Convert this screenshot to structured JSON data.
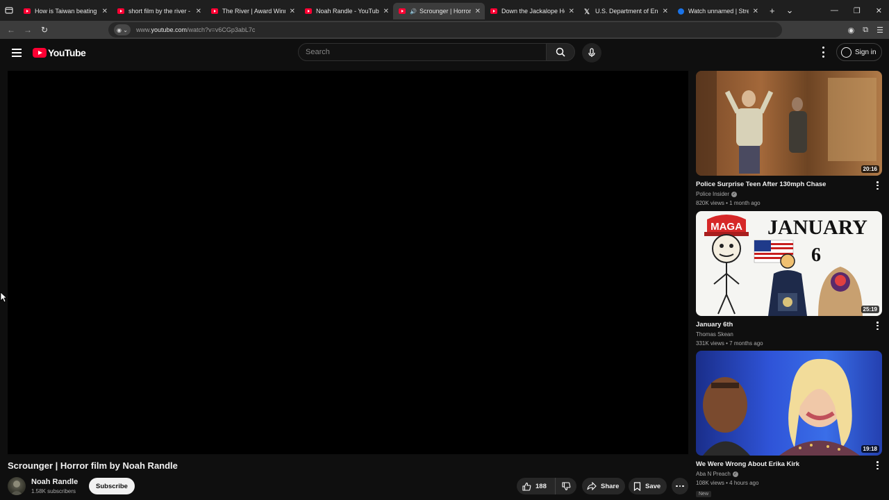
{
  "browser": {
    "tabs": [
      {
        "title": "How is Taiwan beating eve",
        "favicon": "youtube-icon",
        "active": false
      },
      {
        "title": "short film by the river - You",
        "favicon": "youtube-icon",
        "active": false
      },
      {
        "title": "The River | Award Winning",
        "favicon": "youtube-icon",
        "active": false
      },
      {
        "title": "Noah Randle - YouTube",
        "favicon": "youtube-icon",
        "active": false
      },
      {
        "title": "Scrounger | Horror film",
        "favicon": "youtube-icon",
        "active": true,
        "audio": true
      },
      {
        "title": "Down the Jackalope Hole |",
        "favicon": "youtube-icon",
        "active": false
      },
      {
        "title": "U.S. Department of Energy",
        "favicon": "x-icon",
        "active": false
      },
      {
        "title": "Watch unnamed | Strea",
        "favicon": "globe-icon",
        "active": false
      }
    ],
    "url_prefix": "www.",
    "url_host": "youtube.com",
    "url_path": "/watch?v=v6CGp3abL7c"
  },
  "header": {
    "logo_text": "YouTube",
    "search_placeholder": "Search",
    "signin_label": "Sign in"
  },
  "video": {
    "title": "Scrounger | Horror film by Noah Randle",
    "channel_name": "Noah Randle",
    "subscribers": "1.58K subscribers",
    "subscribe_label": "Subscribe",
    "like_count": "188",
    "share_label": "Share",
    "save_label": "Save"
  },
  "recommendations": [
    {
      "title": "Police Surprise Teen After 130mph Chase",
      "channel": "Police Insider",
      "verified": true,
      "meta": "820K views • 1 month ago",
      "duration": "20:16"
    },
    {
      "title": "January 6th",
      "channel": "Thomas Skean",
      "verified": false,
      "meta": "331K views • 7 months ago",
      "duration": "25:19",
      "thumb_text_left": "MAGA",
      "thumb_text_right": "JANUARY",
      "thumb_text_num": "6"
    },
    {
      "title": "We Were Wrong About Erika Kirk",
      "channel": "Aba N Preach",
      "verified": true,
      "meta": "108K views • 4 hours ago",
      "duration": "19:18",
      "badge": "New"
    }
  ],
  "colors": {
    "background": "#0f0f0f",
    "brand_red": "#ff0033",
    "pill_bg": "#272727"
  }
}
